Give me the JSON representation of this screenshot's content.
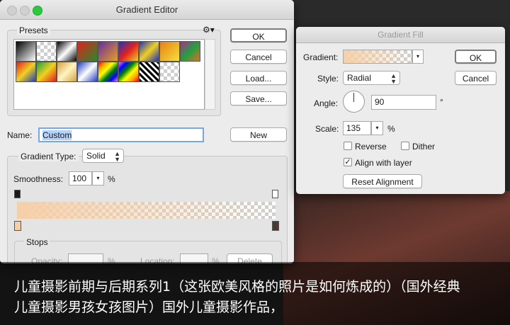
{
  "gradient_editor": {
    "title": "Gradient Editor",
    "presets_label": "Presets",
    "gear_icon": "gear-icon",
    "buttons": {
      "ok": "OK",
      "cancel": "Cancel",
      "load": "Load...",
      "save": "Save..."
    },
    "name_label": "Name:",
    "name_value": "Custom",
    "new_button": "New",
    "gradient_type_label": "Gradient Type:",
    "gradient_type_value": "Solid",
    "smoothness_label": "Smoothness:",
    "smoothness_value": "100",
    "smoothness_unit": "%",
    "stops_label": "Stops",
    "opacity_label": "Opacity:",
    "opacity_unit": "%",
    "location_label": "Location:",
    "location_unit": "%",
    "delete_button": "Delete",
    "colors": {
      "gradient_start": "#f6cfa8",
      "stop_dark": "#4a3a33"
    }
  },
  "gradient_fill": {
    "title": "Gradient Fill",
    "gradient_label": "Gradient:",
    "style_label": "Style:",
    "style_value": "Radial",
    "angle_label": "Angle:",
    "angle_value": "90",
    "angle_unit": "°",
    "scale_label": "Scale:",
    "scale_value": "135",
    "scale_unit": "%",
    "reverse_label": "Reverse",
    "reverse_checked": false,
    "dither_label": "Dither",
    "dither_checked": false,
    "align_label": "Align with layer",
    "align_checked": true,
    "reset_button": "Reset Alignment",
    "ok_button": "OK",
    "cancel_button": "Cancel"
  },
  "caption": {
    "line1": "儿童摄影前期与后期系列1（这张欧美风格的照片是如何炼成的）（国外经典",
    "line2": "儿童摄影男孩女孩图片）国外儿童摄影作品，"
  }
}
